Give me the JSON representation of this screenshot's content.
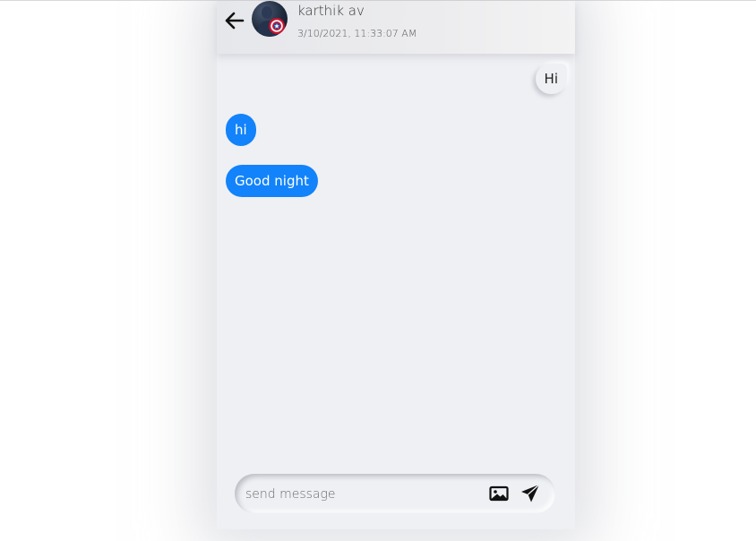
{
  "header": {
    "back_icon": "arrow-left-icon",
    "avatar_icon": "user-avatar",
    "contact_name": "karthik av",
    "last_seen": "3/10/2021, 11:33:07 AM"
  },
  "messages": [
    {
      "direction": "sent",
      "text": "Hi"
    },
    {
      "direction": "received",
      "text": "hi"
    },
    {
      "direction": "received",
      "text": "Good night"
    }
  ],
  "composer": {
    "placeholder": "send message",
    "value": "",
    "image_icon": "image-icon",
    "send_icon": "send-icon"
  },
  "colors": {
    "received_bubble": "#1283fa",
    "background": "#eff0f4"
  }
}
